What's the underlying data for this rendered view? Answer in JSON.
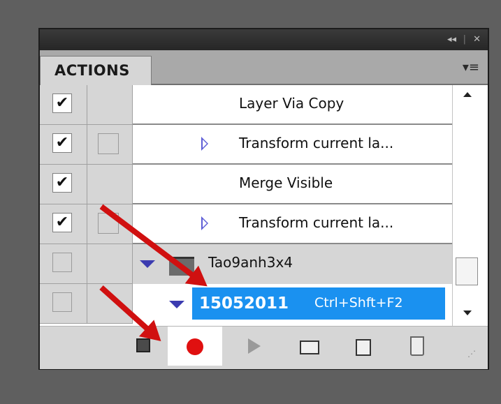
{
  "panel": {
    "tab_label": "ACTIONS",
    "collapse_glyph": "◂◂",
    "close_glyph": "✕",
    "menu_glyph": "▾≡"
  },
  "actions": [
    {
      "label": "Layer Via Copy",
      "checked": true,
      "dialog": false,
      "expandable": false
    },
    {
      "label": "Transform current la...",
      "checked": true,
      "dialog": true,
      "expandable": true
    },
    {
      "label": "Merge Visible",
      "checked": true,
      "dialog": false,
      "expandable": false
    },
    {
      "label": "Transform current la...",
      "checked": true,
      "dialog": true,
      "expandable": true
    }
  ],
  "action_set": {
    "label": "Tao9anh3x4",
    "checked": false
  },
  "selected_action": {
    "label": "15052011",
    "shortcut": "Ctrl+Shft+F2",
    "checked": false
  },
  "toolbar": {
    "stop_icon": "stop-icon",
    "record_icon": "record-icon",
    "play_icon": "play-icon",
    "new_set_icon": "folder-icon",
    "new_action_icon": "new-item-icon",
    "delete_icon": "trash-icon"
  },
  "colors": {
    "highlight": "#1a91f0",
    "record": "#e01010",
    "annotation_arrow": "#d01010",
    "expand_triangle": "#5c5cd6"
  }
}
